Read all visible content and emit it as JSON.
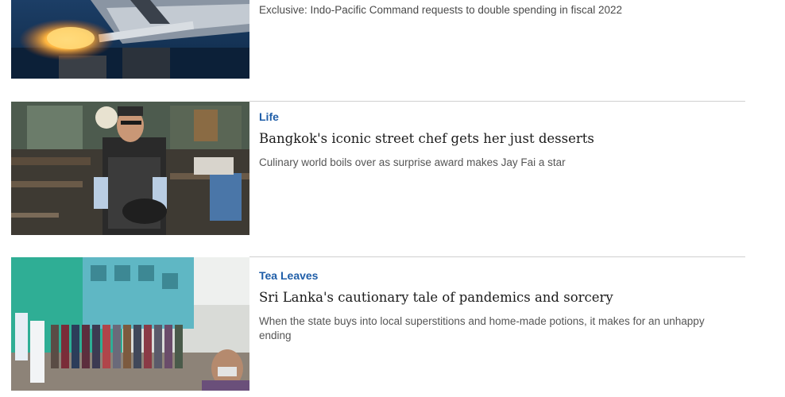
{
  "articles": [
    {
      "image_alt": "missile-launch-image",
      "summary": "Exclusive: Indo-Pacific Command requests to double spending in fiscal 2022"
    },
    {
      "section": "Life",
      "headline": "Bangkok's iconic street chef gets her just desserts",
      "summary": "Culinary world boils over as surprise award makes Jay Fai a star",
      "image_alt": "street-chef-image"
    },
    {
      "section": "Tea Leaves",
      "headline": "Sri Lanka's cautionary tale of pandemics and sorcery",
      "summary": "When the state buys into local superstitions and home-made potions, it makes for an unhappy ending",
      "image_alt": "sri-lanka-queue-image"
    }
  ],
  "colors": {
    "section_link": "#1f5ea8",
    "headline": "#1b1b1b",
    "summary": "#555555",
    "divider": "#cfcfcf"
  }
}
